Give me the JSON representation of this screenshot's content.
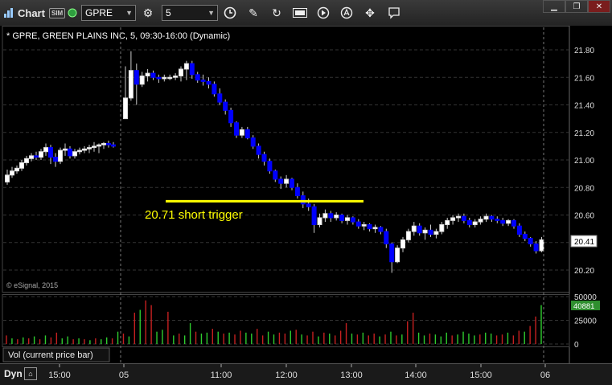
{
  "toolbar": {
    "title": "Chart",
    "sim_badge": "SIM",
    "symbol": "GPRE",
    "interval": "5",
    "icons": [
      "chart-icon",
      "link-icon",
      "settings-icon",
      "clock-icon",
      "pencil-icon",
      "refresh-icon",
      "get-icon",
      "play-icon",
      "alert-icon",
      "tools-icon",
      "comment-icon"
    ]
  },
  "window_controls": [
    "minimize",
    "restore",
    "close"
  ],
  "chart_data": {
    "type": "candlestick",
    "header": "* GPRE, GREEN PLAINS INC, 5, 09:30-16:00 (Dynamic)",
    "watermark": "© eSignal, 2015",
    "annotation": {
      "text": "20.71 short trigger",
      "price": 20.7,
      "color": "#ffff00"
    },
    "last_price_label": "20.41",
    "ylim": [
      20.1,
      21.92
    ],
    "yticks": [
      "21.80",
      "21.60",
      "21.40",
      "21.20",
      "21.00",
      "20.80",
      "20.60",
      "20.40",
      "20.20"
    ],
    "xticks": [
      "15:00",
      "05",
      "11:00",
      "12:00",
      "13:00",
      "14:00",
      "15:00",
      "06"
    ],
    "up_color": "#ffffff",
    "down_color": "#0000ff",
    "candles_day1": [
      [
        20.84,
        20.93,
        20.82,
        20.89
      ],
      [
        20.89,
        20.95,
        20.87,
        20.92
      ],
      [
        20.92,
        20.96,
        20.9,
        20.94
      ],
      [
        20.94,
        21.0,
        20.92,
        20.98
      ],
      [
        20.98,
        21.03,
        20.96,
        21.01
      ],
      [
        21.01,
        21.05,
        20.99,
        21.03
      ],
      [
        21.03,
        21.06,
        21.0,
        21.02
      ],
      [
        21.02,
        21.08,
        21.0,
        21.06
      ],
      [
        21.06,
        21.12,
        21.03,
        21.09
      ],
      [
        21.09,
        21.11,
        20.97,
        21.02
      ],
      [
        21.02,
        21.05,
        20.95,
        20.99
      ],
      [
        20.99,
        21.09,
        20.97,
        21.07
      ],
      [
        21.07,
        21.12,
        21.03,
        21.08
      ],
      [
        21.08,
        21.1,
        21.01,
        21.03
      ],
      [
        21.03,
        21.08,
        21.01,
        21.06
      ],
      [
        21.06,
        21.09,
        21.04,
        21.07
      ],
      [
        21.07,
        21.1,
        21.05,
        21.08
      ],
      [
        21.08,
        21.11,
        21.05,
        21.09
      ],
      [
        21.09,
        21.13,
        21.06,
        21.1
      ],
      [
        21.1,
        21.12,
        21.05,
        21.11
      ],
      [
        21.11,
        21.13,
        21.08,
        21.12
      ],
      [
        21.12,
        21.14,
        21.09,
        21.11
      ],
      [
        21.11,
        21.13,
        21.09,
        21.1
      ]
    ],
    "candles_day2": [
      [
        21.3,
        21.68,
        21.3,
        21.45
      ],
      [
        21.45,
        21.79,
        21.43,
        21.65
      ],
      [
        21.65,
        21.7,
        21.4,
        21.55
      ],
      [
        21.55,
        21.64,
        21.53,
        21.61
      ],
      [
        21.61,
        21.66,
        21.57,
        21.63
      ],
      [
        21.63,
        21.65,
        21.58,
        21.6
      ],
      [
        21.6,
        21.62,
        21.56,
        21.59
      ],
      [
        21.59,
        21.62,
        21.57,
        21.6
      ],
      [
        21.6,
        21.62,
        21.58,
        21.6
      ],
      [
        21.6,
        21.63,
        21.58,
        21.61
      ],
      [
        21.61,
        21.68,
        21.57,
        21.66
      ],
      [
        21.66,
        21.72,
        21.58,
        21.7
      ],
      [
        21.7,
        21.72,
        21.59,
        21.62
      ],
      [
        21.62,
        21.64,
        21.56,
        21.58
      ],
      [
        21.58,
        21.62,
        21.54,
        21.57
      ],
      [
        21.57,
        21.6,
        21.52,
        21.55
      ],
      [
        21.55,
        21.57,
        21.46,
        21.48
      ],
      [
        21.48,
        21.52,
        21.4,
        21.42
      ],
      [
        21.42,
        21.44,
        21.33,
        21.36
      ],
      [
        21.36,
        21.38,
        21.24,
        21.27
      ],
      [
        21.27,
        21.28,
        21.16,
        21.18
      ],
      [
        21.18,
        21.24,
        21.16,
        21.22
      ],
      [
        21.22,
        21.24,
        21.15,
        21.16
      ],
      [
        21.16,
        21.18,
        21.08,
        21.1
      ],
      [
        21.1,
        21.12,
        21.01,
        21.04
      ],
      [
        21.04,
        21.06,
        20.96,
        20.99
      ],
      [
        20.99,
        21.01,
        20.9,
        20.92
      ],
      [
        20.92,
        20.93,
        20.84,
        20.86
      ],
      [
        20.86,
        20.88,
        20.79,
        20.83
      ],
      [
        20.83,
        20.89,
        20.8,
        20.86
      ],
      [
        20.86,
        20.87,
        20.78,
        20.8
      ],
      [
        20.8,
        20.83,
        20.72,
        20.74
      ],
      [
        20.74,
        20.77,
        20.65,
        20.68
      ],
      [
        20.68,
        20.72,
        20.63,
        20.66
      ],
      [
        20.66,
        20.68,
        20.47,
        20.53
      ],
      [
        20.53,
        20.61,
        20.51,
        20.58
      ],
      [
        20.58,
        20.64,
        20.55,
        20.61
      ],
      [
        20.61,
        20.63,
        20.55,
        20.58
      ],
      [
        20.58,
        20.62,
        20.56,
        20.6
      ],
      [
        20.6,
        20.61,
        20.54,
        20.56
      ],
      [
        20.56,
        20.6,
        20.53,
        20.58
      ],
      [
        20.58,
        20.59,
        20.53,
        20.55
      ],
      [
        20.55,
        20.57,
        20.5,
        20.52
      ],
      [
        20.52,
        20.55,
        20.49,
        20.53
      ],
      [
        20.53,
        20.54,
        20.48,
        20.5
      ],
      [
        20.5,
        20.53,
        20.47,
        20.51
      ],
      [
        20.51,
        20.52,
        20.46,
        20.48
      ],
      [
        20.48,
        20.5,
        20.36,
        20.39
      ],
      [
        20.39,
        20.4,
        20.18,
        20.26
      ],
      [
        20.26,
        20.38,
        20.25,
        20.36
      ],
      [
        20.36,
        20.44,
        20.33,
        20.42
      ],
      [
        20.42,
        20.5,
        20.4,
        20.48
      ],
      [
        20.48,
        20.55,
        20.45,
        20.52
      ],
      [
        20.52,
        20.54,
        20.45,
        20.47
      ],
      [
        20.47,
        20.51,
        20.42,
        20.49
      ],
      [
        20.49,
        20.53,
        20.44,
        20.46
      ],
      [
        20.46,
        20.5,
        20.43,
        20.48
      ],
      [
        20.48,
        20.55,
        20.46,
        20.53
      ],
      [
        20.53,
        20.58,
        20.5,
        20.56
      ],
      [
        20.56,
        20.6,
        20.53,
        20.58
      ],
      [
        20.58,
        20.61,
        20.55,
        20.59
      ],
      [
        20.59,
        20.61,
        20.54,
        20.56
      ],
      [
        20.56,
        20.58,
        20.51,
        20.53
      ],
      [
        20.53,
        20.57,
        20.51,
        20.55
      ],
      [
        20.55,
        20.59,
        20.53,
        20.57
      ],
      [
        20.57,
        20.61,
        20.55,
        20.59
      ],
      [
        20.59,
        20.6,
        20.55,
        20.57
      ],
      [
        20.57,
        20.59,
        20.54,
        20.56
      ],
      [
        20.56,
        20.58,
        20.52,
        20.54
      ],
      [
        20.54,
        20.57,
        20.52,
        20.56
      ],
      [
        20.56,
        20.57,
        20.5,
        20.52
      ],
      [
        20.52,
        20.54,
        20.44,
        20.46
      ],
      [
        20.46,
        20.48,
        20.41,
        20.43
      ],
      [
        20.43,
        20.44,
        20.37,
        20.39
      ],
      [
        20.39,
        20.41,
        20.32,
        20.34
      ],
      [
        20.34,
        20.44,
        20.33,
        20.42
      ]
    ],
    "volume_label": "Vol (current price bar)",
    "volume_last_label": "40881",
    "volume_yticks": [
      "50000",
      "25000",
      "0"
    ],
    "volume_ylim": [
      0,
      55000
    ],
    "volume": [
      [
        9000,
        "r"
      ],
      [
        6000,
        "g"
      ],
      [
        5000,
        "r"
      ],
      [
        7000,
        "g"
      ],
      [
        6000,
        "r"
      ],
      [
        8000,
        "g"
      ],
      [
        5000,
        "r"
      ],
      [
        9000,
        "g"
      ],
      [
        7000,
        "r"
      ],
      [
        12000,
        "r"
      ],
      [
        6000,
        "g"
      ],
      [
        8000,
        "g"
      ],
      [
        5000,
        "r"
      ],
      [
        6000,
        "g"
      ],
      [
        5000,
        "r"
      ],
      [
        4000,
        "g"
      ],
      [
        6000,
        "r"
      ],
      [
        5000,
        "g"
      ],
      [
        7000,
        "g"
      ],
      [
        6000,
        "r"
      ],
      [
        13000,
        "g"
      ],
      [
        11000,
        "r"
      ],
      [
        8000,
        "g"
      ],
      [
        33000,
        "r"
      ],
      [
        36000,
        "g"
      ],
      [
        46000,
        "r"
      ],
      [
        41000,
        "r"
      ],
      [
        13000,
        "g"
      ],
      [
        15000,
        "g"
      ],
      [
        34000,
        "r"
      ],
      [
        9000,
        "g"
      ],
      [
        11000,
        "r"
      ],
      [
        9000,
        "g"
      ],
      [
        22000,
        "g"
      ],
      [
        13000,
        "r"
      ],
      [
        11000,
        "g"
      ],
      [
        12000,
        "g"
      ],
      [
        16000,
        "r"
      ],
      [
        13000,
        "g"
      ],
      [
        11000,
        "r"
      ],
      [
        12000,
        "g"
      ],
      [
        10000,
        "r"
      ],
      [
        14000,
        "r"
      ],
      [
        12000,
        "g"
      ],
      [
        11000,
        "g"
      ],
      [
        16000,
        "r"
      ],
      [
        9000,
        "r"
      ],
      [
        13000,
        "g"
      ],
      [
        10000,
        "g"
      ],
      [
        12000,
        "r"
      ],
      [
        11000,
        "r"
      ],
      [
        14000,
        "g"
      ],
      [
        15000,
        "r"
      ],
      [
        10000,
        "g"
      ],
      [
        9000,
        "r"
      ],
      [
        13000,
        "r"
      ],
      [
        8000,
        "g"
      ],
      [
        12000,
        "r"
      ],
      [
        11000,
        "g"
      ],
      [
        9000,
        "r"
      ],
      [
        14000,
        "r"
      ],
      [
        22000,
        "r"
      ],
      [
        11000,
        "g"
      ],
      [
        10000,
        "r"
      ],
      [
        12000,
        "g"
      ],
      [
        9000,
        "r"
      ],
      [
        11000,
        "r"
      ],
      [
        8000,
        "g"
      ],
      [
        10000,
        "r"
      ],
      [
        13000,
        "g"
      ],
      [
        9000,
        "r"
      ],
      [
        10000,
        "g"
      ],
      [
        24000,
        "r"
      ],
      [
        33000,
        "r"
      ],
      [
        12000,
        "g"
      ],
      [
        9000,
        "g"
      ],
      [
        11000,
        "r"
      ],
      [
        10000,
        "g"
      ],
      [
        8000,
        "g"
      ],
      [
        12000,
        "g"
      ],
      [
        9000,
        "r"
      ],
      [
        10000,
        "g"
      ],
      [
        13000,
        "g"
      ],
      [
        11000,
        "g"
      ],
      [
        9000,
        "g"
      ],
      [
        10000,
        "r"
      ],
      [
        12000,
        "g"
      ],
      [
        11000,
        "g"
      ],
      [
        9000,
        "r"
      ],
      [
        10000,
        "r"
      ],
      [
        12000,
        "g"
      ],
      [
        9000,
        "r"
      ],
      [
        14000,
        "r"
      ],
      [
        13000,
        "g"
      ],
      [
        19000,
        "r"
      ],
      [
        29000,
        "r"
      ],
      [
        41000,
        "g"
      ]
    ]
  },
  "bottom": {
    "mode_label": "Dyn"
  }
}
